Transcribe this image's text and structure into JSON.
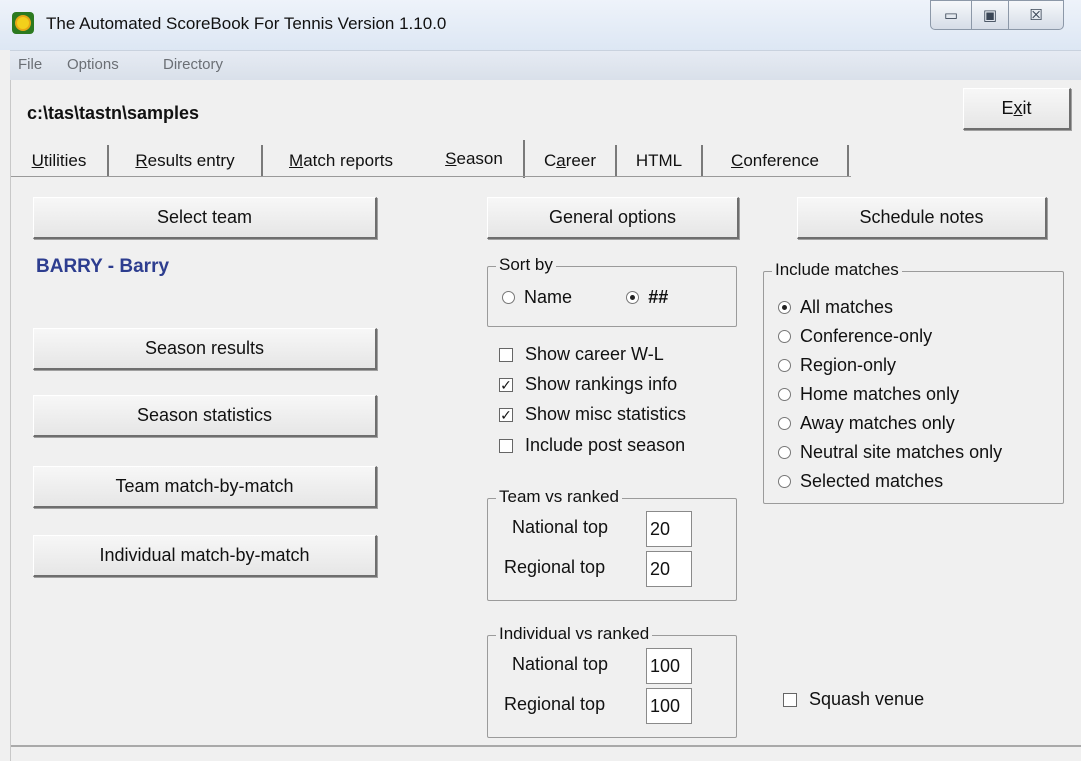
{
  "window": {
    "title": "The Automated ScoreBook For Tennis  Version 1.10.0",
    "minimize_glyph": "▭",
    "maximize_glyph": "▣",
    "close_glyph": "☒"
  },
  "menu": [
    "File",
    "Options",
    "Directory"
  ],
  "path": "c:\\tas\\tastn\\samples",
  "exit_button": "Exit",
  "tabs": [
    {
      "pre": "",
      "ul": "U",
      "post": "tilities"
    },
    {
      "pre": "",
      "ul": "R",
      "post": "esults entry"
    },
    {
      "pre": "",
      "ul": "M",
      "post": "atch reports"
    },
    {
      "pre": "",
      "ul": "S",
      "post": "eason"
    },
    {
      "pre": "C",
      "ul": "a",
      "post": "reer"
    },
    {
      "pre": "HTML",
      "ul": "",
      "post": ""
    },
    {
      "pre": "",
      "ul": "C",
      "post": "onference"
    }
  ],
  "active_tab": "Season",
  "left": {
    "select_team": "Select team",
    "team_name": "BARRY - Barry",
    "season_results": "Season results",
    "season_statistics": "Season statistics",
    "team_match": "Team match-by-match",
    "individual_match": "Individual match-by-match"
  },
  "middle": {
    "general_options": "General options",
    "sort_by": {
      "legend": "Sort by",
      "options": [
        "Name",
        "##"
      ],
      "selected": "##"
    },
    "checks": [
      {
        "label": "Show career W-L",
        "checked": false
      },
      {
        "label": "Show rankings info",
        "checked": true
      },
      {
        "label": "Show misc statistics",
        "checked": true
      },
      {
        "label": "Include post season",
        "checked": false
      }
    ],
    "team_vs_ranked": {
      "legend": "Team vs ranked",
      "national_label": "National top",
      "national_value": "20",
      "regional_label": "Regional top",
      "regional_value": "20"
    },
    "individual_vs_ranked": {
      "legend": "Individual vs ranked",
      "national_label": "National top",
      "national_value": "100",
      "regional_label": "Regional top",
      "regional_value": "100"
    }
  },
  "right": {
    "schedule_notes": "Schedule notes",
    "include_matches": {
      "legend": "Include matches",
      "options": [
        "All matches",
        "Conference-only",
        "Region-only",
        "Home matches only",
        "Away matches only",
        "Neutral site matches only",
        "Selected matches"
      ],
      "selected": "All matches"
    },
    "squash_venue": {
      "label": "Squash venue",
      "checked": false
    }
  },
  "colors": {
    "team_name": "#2d3d8f",
    "background": "#f0f0f0"
  }
}
